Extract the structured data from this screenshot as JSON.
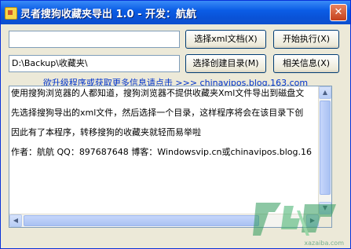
{
  "window": {
    "title": "灵者搜狗收藏夹导出 1.0 - 开发：航航",
    "close_glyph": "✕"
  },
  "form": {
    "path_input_value": "",
    "path_button_label": "选择xml文档(X)",
    "start_button_label": "开始执行(X)",
    "dir_input_value": "D:\\Backup\\收藏夹\\",
    "dir_button_label": "选择创建目录(M)",
    "info_button_label": "相关信息(X)"
  },
  "link": {
    "text": "欲升级程序或获取更多信息请点击 >>> chinavipos.blog.163.com"
  },
  "description": {
    "lines": [
      "使用搜狗浏览器的人都知道，搜狗浏览器不提供收藏夹Xml文件导出到磁盘文",
      "先选择搜狗导出的xml文件，然后选择一个目录，这样程序将会在该目录下创",
      "因此有了本程序，转移搜狗的收藏夹就轻而易举啦",
      "作者：航航    QQ：897687648    博客：Windowsvip.cn或chinavipos.blog.16"
    ]
  },
  "watermark": {
    "text": "xazaiba.com"
  },
  "colors": {
    "titlebar": "#0b5de6",
    "link": "#0033cc",
    "watermark": "#2f9a5a"
  }
}
